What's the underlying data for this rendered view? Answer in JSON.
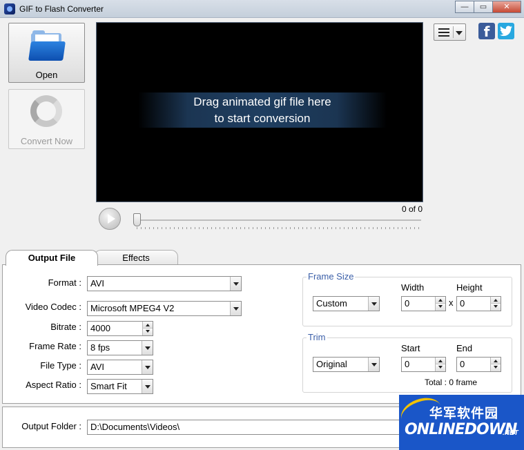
{
  "window": {
    "title": "GIF to Flash Converter",
    "min_glyph": "—",
    "max_glyph": "▭",
    "close_glyph": "✕"
  },
  "left": {
    "open_label": "Open",
    "convert_label": "Convert Now"
  },
  "preview": {
    "line1": "Drag animated gif file here",
    "line2": "to start conversion",
    "counter": "0 of 0",
    "progress": 0
  },
  "social": {
    "fb_glyph": "f",
    "tw_glyph": "🐦"
  },
  "tabs": [
    {
      "label": "Output File",
      "active": true
    },
    {
      "label": "Effects",
      "active": false
    }
  ],
  "output": {
    "format_label": "Format :",
    "format_value": "AVI",
    "codec_label": "Video Codec :",
    "codec_value": "Microsoft MPEG4 V2",
    "bitrate_label": "Bitrate :",
    "bitrate_value": "4000",
    "framerate_label": "Frame Rate :",
    "framerate_value": "8 fps",
    "filetype_label": "File Type :",
    "filetype_value": "AVI",
    "aspect_label": "Aspect Ratio :",
    "aspect_value": "Smart Fit"
  },
  "frame_size": {
    "title": "Frame Size",
    "preset": "Custom",
    "width_label": "Width",
    "width_value": "0",
    "height_label": "Height",
    "height_value": "0",
    "times": "x"
  },
  "trim": {
    "title": "Trim",
    "preset": "Original",
    "start_label": "Start",
    "start_value": "0",
    "end_label": "End",
    "end_value": "0",
    "total": "Total : 0 frame"
  },
  "folder": {
    "label": "Output Folder :",
    "value": "D:\\Documents\\Videos\\"
  },
  "watermark": {
    "cn": "华军软件园",
    "en": "ONLINEDOWN",
    "net": ".NET"
  }
}
